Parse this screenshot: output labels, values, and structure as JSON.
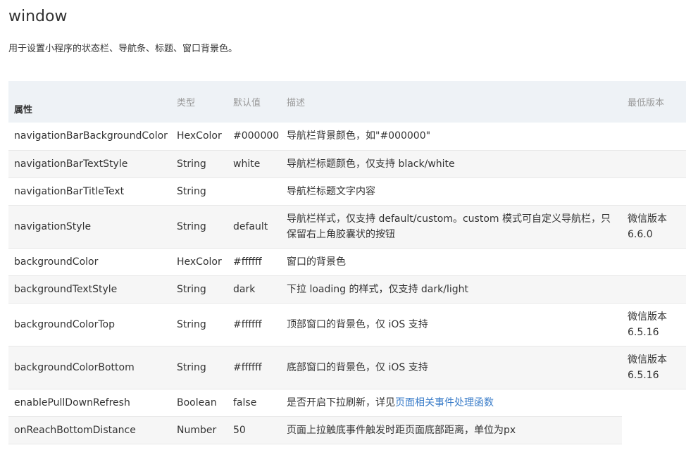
{
  "header": {
    "title": "window",
    "description": "用于设置小程序的状态栏、导航条、标题、窗口背景色。"
  },
  "table": {
    "columns": {
      "name": "属性",
      "type": "类型",
      "default": "默认值",
      "desc": "描述",
      "since": "最低版本"
    },
    "rows": [
      {
        "name": "navigationBarBackgroundColor",
        "type": "HexColor",
        "default": "#000000",
        "desc": "导航栏背景颜色，如\"#000000\"",
        "since": ""
      },
      {
        "name": "navigationBarTextStyle",
        "type": "String",
        "default": "white",
        "desc": "导航栏标题颜色，仅支持 black/white",
        "since": ""
      },
      {
        "name": "navigationBarTitleText",
        "type": "String",
        "default": "",
        "desc": "导航栏标题文字内容",
        "since": ""
      },
      {
        "name": "navigationStyle",
        "type": "String",
        "default": "default",
        "desc": "导航栏样式，仅支持 default/custom。custom 模式可自定义导航栏，只保留右上角胶囊状的按钮",
        "since": "微信版本 6.6.0"
      },
      {
        "name": "backgroundColor",
        "type": "HexColor",
        "default": "#ffffff",
        "desc": "窗口的背景色",
        "since": ""
      },
      {
        "name": "backgroundTextStyle",
        "type": "String",
        "default": "dark",
        "desc": "下拉 loading 的样式，仅支持 dark/light",
        "since": ""
      },
      {
        "name": "backgroundColorTop",
        "type": "String",
        "default": "#ffffff",
        "desc": "顶部窗口的背景色，仅 iOS 支持",
        "since": "微信版本 6.5.16"
      },
      {
        "name": "backgroundColorBottom",
        "type": "String",
        "default": "#ffffff",
        "desc": "底部窗口的背景色，仅 iOS 支持",
        "since": "微信版本 6.5.16"
      },
      {
        "name": "enablePullDownRefresh",
        "type": "Boolean",
        "default": "false",
        "desc": "是否开启下拉刷新，详见",
        "desc_link": "页面相关事件处理函数",
        "since": ""
      },
      {
        "name": "onReachBottomDistance",
        "type": "Number",
        "default": "50",
        "desc": "页面上拉触底事件触发时距页面底部距离，单位为px",
        "since": ""
      }
    ]
  },
  "colors": {
    "link": "#3b7dc9",
    "header_bg": "#eef2f6",
    "stripe_bg": "#f6f6f6"
  }
}
